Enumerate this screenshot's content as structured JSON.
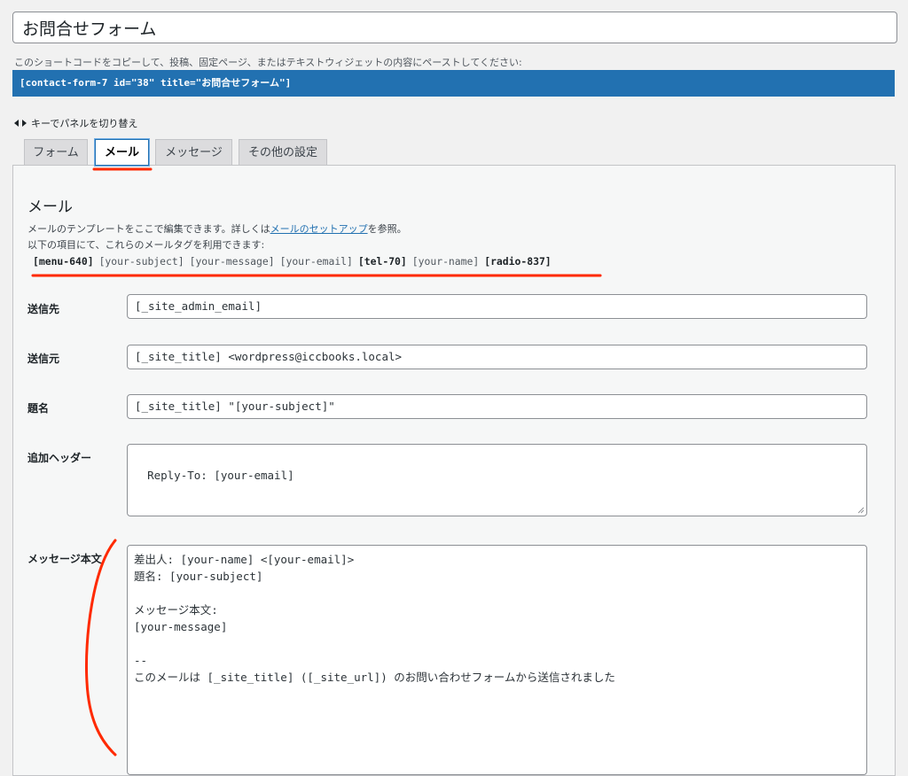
{
  "form_title": "お問合せフォーム",
  "shortcode": {
    "hint": "このショートコードをコピーして、投稿、固定ページ、またはテキストウィジェットの内容にペーストしてください:",
    "code": "[contact-form-7 id=\"38\" title=\"お問合せフォーム\"]"
  },
  "keyboard_hint": {
    "icon": "arrow-left-right-icon",
    "text": "キーでパネルを切り替え"
  },
  "tabs": [
    {
      "label": "フォーム",
      "active": false
    },
    {
      "label": "メール",
      "active": true
    },
    {
      "label": "メッセージ",
      "active": false
    },
    {
      "label": "その他の設定",
      "active": false
    }
  ],
  "mail_panel": {
    "title": "メール",
    "desc_prefix": "メールのテンプレートをここで編集できます。詳しくは",
    "desc_link": "メールのセットアップ",
    "desc_suffix": "を参照。",
    "tags_intro": "以下の項目にて、これらのメールタグを利用できます:",
    "tags": [
      {
        "text": "[menu-640]",
        "used": true
      },
      {
        "text": "[your-subject]",
        "used": false
      },
      {
        "text": "[your-message]",
        "used": false
      },
      {
        "text": "[your-email]",
        "used": false
      },
      {
        "text": "[tel-70]",
        "used": true
      },
      {
        "text": "[your-name]",
        "used": false
      },
      {
        "text": "[radio-837]",
        "used": true
      }
    ]
  },
  "fields": {
    "to": {
      "label": "送信先",
      "value": "[_site_admin_email]"
    },
    "from": {
      "label": "送信元",
      "value": "[_site_title] <wordpress@iccbooks.local>"
    },
    "subject": {
      "label": "題名",
      "value": "[_site_title] \"[your-subject]\""
    },
    "headers": {
      "label": "追加ヘッダー",
      "value": "Reply-To: [your-email]"
    },
    "body": {
      "label": "メッセージ本文",
      "value": "差出人: [your-name] <[your-email]>\n題名: [your-subject]\n\nメッセージ本文:\n[your-message]\n\n-- \nこのメールは [_site_title] ([_site_url]) のお問い合わせフォームから送信されました"
    }
  },
  "colors": {
    "accent": "#2271b1",
    "annotation_red": "#ff2a00"
  }
}
